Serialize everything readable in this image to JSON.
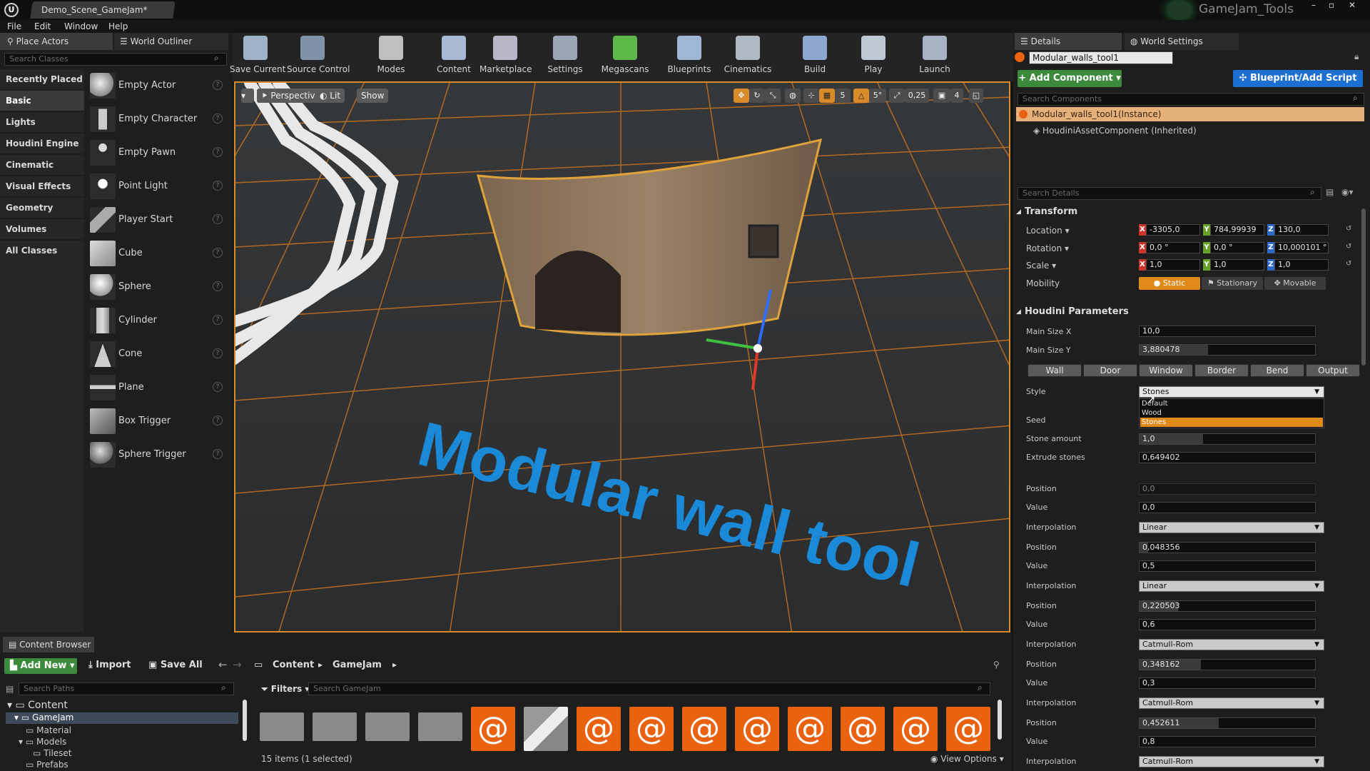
{
  "window": {
    "tab": "Demo_Scene_GameJam*",
    "project": "GameJam_Tools"
  },
  "menu": [
    "File",
    "Edit",
    "Window",
    "Help"
  ],
  "places": {
    "tabs": [
      "Place Actors",
      "World Outliner"
    ],
    "search_placeholder": "Search Classes",
    "categories": [
      "Recently Placed",
      "Basic",
      "Lights",
      "Houdini Engine",
      "Cinematic",
      "Visual Effects",
      "Geometry",
      "Volumes",
      "All Classes"
    ],
    "actors": [
      "Empty Actor",
      "Empty Character",
      "Empty Pawn",
      "Point Light",
      "Player Start",
      "Cube",
      "Sphere",
      "Cylinder",
      "Cone",
      "Plane",
      "Box Trigger",
      "Sphere Trigger"
    ]
  },
  "toolbar": [
    {
      "label": "Save Current",
      "icon": "save-icon",
      "color": "#9fb3c8"
    },
    {
      "label": "Source Control",
      "icon": "source-control-icon",
      "color": "#7f92a8"
    },
    {
      "label": "Modes",
      "icon": "modes-icon",
      "color": "#c0c0c0"
    },
    {
      "label": "Content",
      "icon": "content-icon",
      "color": "#a9b9d3"
    },
    {
      "label": "Marketplace",
      "icon": "marketplace-icon",
      "color": "#b7b7c7"
    },
    {
      "label": "Settings",
      "icon": "settings-icon",
      "color": "#9aa6b8"
    },
    {
      "label": "Megascans",
      "icon": "megascans-icon",
      "color": "#5cb84a"
    },
    {
      "label": "Blueprints",
      "icon": "blueprints-icon",
      "color": "#9fb6d6"
    },
    {
      "label": "Cinematics",
      "icon": "cinematics-icon",
      "color": "#b0b8c4"
    },
    {
      "label": "Build",
      "icon": "build-icon",
      "color": "#8ea7cf"
    },
    {
      "label": "Play",
      "icon": "play-icon",
      "color": "#bfc9d6"
    },
    {
      "label": "Launch",
      "icon": "launch-icon",
      "color": "#a7b3c2"
    }
  ],
  "viewport": {
    "perspective": "Perspective",
    "lit": "Lit",
    "show": "Show",
    "grid_snap": "5",
    "rot_snap": "5°",
    "scale_snap": "0,25",
    "cam_speed": "4",
    "overlay_text": "Modular wall tool"
  },
  "details": {
    "tabs": [
      "Details",
      "World Settings"
    ],
    "actor_name": "Modular_walls_tool1",
    "add_component": "+ Add Component",
    "blueprint_btn": "Blueprint/Add Script",
    "search_components": "Search Components",
    "instance": "Modular_walls_tool1(Instance)",
    "component": "HoudiniAssetComponent (Inherited)",
    "search_details": "Search Details",
    "transform": {
      "title": "Transform",
      "location_label": "Location",
      "rotation_label": "Rotation",
      "scale_label": "Scale",
      "mobility_label": "Mobility",
      "location": [
        "-3305,0",
        "784,99939",
        "130,0"
      ],
      "rotation": [
        "0,0 °",
        "0,0 °",
        "10,000101 °"
      ],
      "scale": [
        "1,0",
        "1,0",
        "1,0"
      ],
      "mobility": [
        "Static",
        "Stationary",
        "Movable"
      ]
    },
    "houdini": {
      "title": "Houdini Parameters",
      "main_size_x_label": "Main Size X",
      "main_size_x": "10,0",
      "main_size_y_label": "Main Size Y",
      "main_size_y": "3,880478",
      "main_size_y_fill": 0.39,
      "tabs": [
        "Wall",
        "Door",
        "Window",
        "Border",
        "Bend",
        "Output"
      ],
      "style_label": "Style",
      "style_value": "Stones",
      "style_options": [
        "Default",
        "Wood",
        "Stones"
      ],
      "seed_label": "Seed",
      "stone_amount_label": "Stone amount",
      "stone_amount": "1,0",
      "stone_amount_fill": 0.36,
      "extrude_label": "Extrude stones",
      "extrude": "0,649402",
      "ramp": [
        {
          "pos_label": "Position",
          "pos": "0,0",
          "pos_fill": 0.0,
          "val_label": "Value",
          "val": "0,0",
          "interp_label": "Interpolation",
          "interp": "Linear"
        },
        {
          "pos_label": "Position",
          "pos": "0,048356",
          "pos_fill": 0.05,
          "val_label": "Value",
          "val": "0,5",
          "interp_label": "Interpolation",
          "interp": "Linear"
        },
        {
          "pos_label": "Position",
          "pos": "0,220503",
          "pos_fill": 0.22,
          "val_label": "Value",
          "val": "0,6",
          "interp_label": "Interpolation",
          "interp": "Catmull-Rom"
        },
        {
          "pos_label": "Position",
          "pos": "0,348162",
          "pos_fill": 0.35,
          "val_label": "Value",
          "val": "0,3",
          "interp_label": "Interpolation",
          "interp": "Catmull-Rom"
        },
        {
          "pos_label": "Position",
          "pos": "0,452611",
          "pos_fill": 0.45,
          "val_label": "Value",
          "val": "0,8",
          "interp_label": "Interpolation",
          "interp": "Catmull-Rom"
        }
      ]
    }
  },
  "content_browser": {
    "tab": "Content Browser",
    "add_new": "Add New",
    "import": "Import",
    "save_all": "Save All",
    "path": [
      "Content",
      "GameJam"
    ],
    "search_paths": "Search Paths",
    "filters": "Filters",
    "search_gamejam": "Search GameJam",
    "tree": [
      "Content",
      "GameJam",
      "Material",
      "Models",
      "Tileset",
      "Prefabs"
    ],
    "status": "15 items (1 selected)",
    "view_options": "View Options"
  }
}
